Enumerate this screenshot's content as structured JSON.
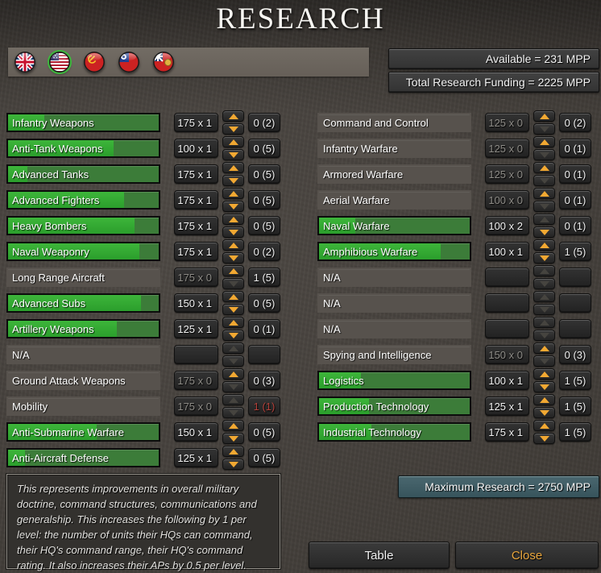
{
  "title": "RESEARCH",
  "header": {
    "available": "Available =  231 MPP",
    "total_funding": "Total Research Funding =  2225 MPP"
  },
  "flags": [
    {
      "name": "uk-flag",
      "selected": false
    },
    {
      "name": "usa-flag",
      "selected": true
    },
    {
      "name": "ussr-flag",
      "selected": false
    },
    {
      "name": "china-flag",
      "selected": false
    },
    {
      "name": "colonial-ensign-flag",
      "selected": false
    }
  ],
  "left_rows": [
    {
      "label": "Infantry Weapons",
      "active": true,
      "fill": 24,
      "cost": "175 x 1",
      "cost_dim": false,
      "up": true,
      "down": true,
      "level": "0 (2)",
      "level_red": false
    },
    {
      "label": "Anti-Tank Weapons",
      "active": true,
      "fill": 70,
      "cost": "100 x 1",
      "cost_dim": false,
      "up": true,
      "down": true,
      "level": "0 (5)",
      "level_red": false
    },
    {
      "label": "Advanced Tanks",
      "active": true,
      "fill": 13,
      "cost": "175 x 1",
      "cost_dim": false,
      "up": true,
      "down": true,
      "level": "0 (5)",
      "level_red": false
    },
    {
      "label": "Advanced Fighters",
      "active": true,
      "fill": 77,
      "cost": "175 x 1",
      "cost_dim": false,
      "up": true,
      "down": true,
      "level": "0 (5)",
      "level_red": false
    },
    {
      "label": "Heavy Bombers",
      "active": true,
      "fill": 84,
      "cost": "175 x 1",
      "cost_dim": false,
      "up": true,
      "down": true,
      "level": "0 (5)",
      "level_red": false
    },
    {
      "label": "Naval Weaponry",
      "active": true,
      "fill": 87,
      "cost": "175 x 1",
      "cost_dim": false,
      "up": true,
      "down": true,
      "level": "0 (2)",
      "level_red": false
    },
    {
      "label": "Long Range Aircraft",
      "active": false,
      "fill": 0,
      "cost": "175 x 0",
      "cost_dim": true,
      "up": true,
      "down": false,
      "level": "1 (5)",
      "level_red": false
    },
    {
      "label": "Advanced Subs",
      "active": true,
      "fill": 88,
      "cost": "150 x 1",
      "cost_dim": false,
      "up": true,
      "down": true,
      "level": "0 (5)",
      "level_red": false
    },
    {
      "label": "Artillery Weapons",
      "active": true,
      "fill": 72,
      "cost": "125 x 1",
      "cost_dim": false,
      "up": true,
      "down": true,
      "level": "0 (1)",
      "level_red": false
    },
    {
      "label": "N/A",
      "active": false,
      "fill": 0,
      "cost": "",
      "cost_dim": true,
      "up": false,
      "down": false,
      "level": "",
      "level_red": false
    },
    {
      "label": "Ground Attack Weapons",
      "active": false,
      "fill": 0,
      "cost": "175 x 0",
      "cost_dim": true,
      "up": true,
      "down": false,
      "level": "0 (3)",
      "level_red": false
    },
    {
      "label": "Mobility",
      "active": false,
      "fill": 0,
      "cost": "175 x 0",
      "cost_dim": true,
      "up": false,
      "down": false,
      "level": "1 (1)",
      "level_red": true
    },
    {
      "label": "Anti-Submarine Warfare",
      "active": true,
      "fill": 59,
      "cost": "150 x 1",
      "cost_dim": false,
      "up": true,
      "down": true,
      "level": "0 (5)",
      "level_red": false
    },
    {
      "label": "Anti-Aircraft Defense",
      "active": true,
      "fill": 11,
      "cost": "125 x 1",
      "cost_dim": false,
      "up": true,
      "down": true,
      "level": "0 (5)",
      "level_red": false
    }
  ],
  "right_rows": [
    {
      "label": "Command and Control",
      "active": false,
      "fill": 0,
      "cost": "125 x 0",
      "cost_dim": true,
      "up": true,
      "down": false,
      "level": "0 (2)",
      "level_red": false
    },
    {
      "label": "Infantry Warfare",
      "active": false,
      "fill": 0,
      "cost": "125 x 0",
      "cost_dim": true,
      "up": true,
      "down": false,
      "level": "0 (1)",
      "level_red": false
    },
    {
      "label": "Armored Warfare",
      "active": false,
      "fill": 0,
      "cost": "125 x 0",
      "cost_dim": true,
      "up": true,
      "down": false,
      "level": "0 (1)",
      "level_red": false
    },
    {
      "label": "Aerial Warfare",
      "active": false,
      "fill": 0,
      "cost": "100 x 0",
      "cost_dim": true,
      "up": true,
      "down": false,
      "level": "0 (1)",
      "level_red": false
    },
    {
      "label": "Naval Warfare",
      "active": true,
      "fill": 24,
      "cost": "100 x 2",
      "cost_dim": false,
      "up": false,
      "down": true,
      "level": "0 (1)",
      "level_red": false
    },
    {
      "label": "Amphibious Warfare",
      "active": true,
      "fill": 81,
      "cost": "100 x 1",
      "cost_dim": false,
      "up": true,
      "down": true,
      "level": "1 (5)",
      "level_red": false
    },
    {
      "label": "N/A",
      "active": false,
      "fill": 0,
      "cost": "",
      "cost_dim": true,
      "up": false,
      "down": false,
      "level": "",
      "level_red": false
    },
    {
      "label": "N/A",
      "active": false,
      "fill": 0,
      "cost": "",
      "cost_dim": true,
      "up": false,
      "down": false,
      "level": "",
      "level_red": false
    },
    {
      "label": "N/A",
      "active": false,
      "fill": 0,
      "cost": "",
      "cost_dim": true,
      "up": false,
      "down": false,
      "level": "",
      "level_red": false
    },
    {
      "label": "Spying and Intelligence",
      "active": false,
      "fill": 0,
      "cost": "150 x 0",
      "cost_dim": true,
      "up": true,
      "down": false,
      "level": "0 (3)",
      "level_red": false
    },
    {
      "label": "Logistics",
      "active": true,
      "fill": 28,
      "cost": "100 x 1",
      "cost_dim": false,
      "up": true,
      "down": true,
      "level": "1 (5)",
      "level_red": false
    },
    {
      "label": "Production Technology",
      "active": true,
      "fill": 33,
      "cost": "125 x 1",
      "cost_dim": false,
      "up": true,
      "down": true,
      "level": "1 (5)",
      "level_red": false
    },
    {
      "label": "Industrial Technology",
      "active": true,
      "fill": 35,
      "cost": "175 x 1",
      "cost_dim": false,
      "up": true,
      "down": true,
      "level": "1 (5)",
      "level_red": false
    }
  ],
  "description": "This represents improvements in overall military doctrine, command structures, communications and generalship. This increases the following by 1 per level: the number of units their HQs can command, their HQ's command range, their HQ's command rating. It also increases their APs by 0.5 per level.",
  "footer": {
    "maximum_research": "Maximum Research =  2750 MPP",
    "table_label": "Table",
    "close_label": "Close"
  },
  "colors": {
    "progress_fill": "#2fa42f",
    "progress_bg": "#3c7c39",
    "inactive_bar": "#57524d",
    "arrow_bright": "#f1a832",
    "arrow_dim": "#46443f",
    "level_warning_text": "#b5413a",
    "max_research_bg": "#3d5a63",
    "close_text": "#e9a63c"
  }
}
